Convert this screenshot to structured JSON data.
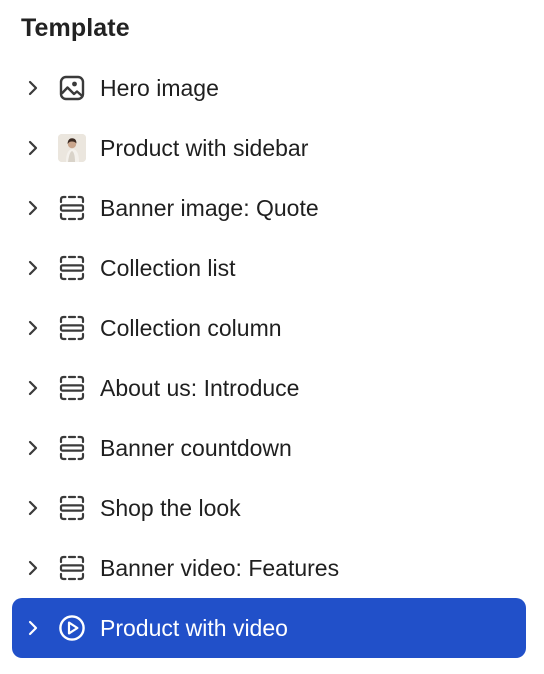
{
  "panel": {
    "title": "Template"
  },
  "colors": {
    "selected_background": "#2150c9",
    "text": "#1f1f1f",
    "icon": "#3a3a3a"
  },
  "sections": [
    {
      "label": "Hero image",
      "icon": "image-icon",
      "selected": false
    },
    {
      "label": "Product with sidebar",
      "icon": "product-thumbnail",
      "selected": false
    },
    {
      "label": "Banner image: Quote",
      "icon": "section-dashed-icon",
      "selected": false
    },
    {
      "label": "Collection list",
      "icon": "section-dashed-icon",
      "selected": false
    },
    {
      "label": "Collection column",
      "icon": "section-dashed-icon",
      "selected": false
    },
    {
      "label": "About us: Introduce",
      "icon": "section-dashed-icon",
      "selected": false
    },
    {
      "label": "Banner countdown",
      "icon": "section-dashed-icon",
      "selected": false
    },
    {
      "label": "Shop the look",
      "icon": "section-dashed-icon",
      "selected": false
    },
    {
      "label": "Banner video: Features",
      "icon": "section-dashed-icon",
      "selected": false
    },
    {
      "label": "Product with video",
      "icon": "play-circle-icon",
      "selected": true
    }
  ]
}
